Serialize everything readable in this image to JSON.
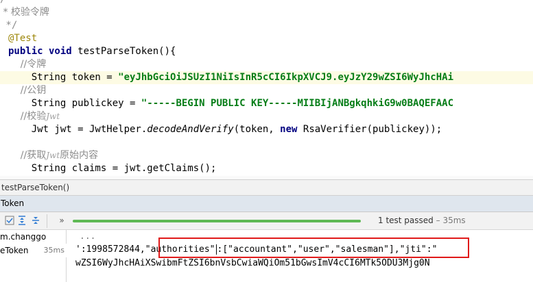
{
  "editor": {
    "lines": [
      {
        "text": "/**"
      },
      {
        "text": " * 校验令牌"
      },
      {
        "text": " */"
      },
      {
        "text": "@Test"
      },
      {
        "kw": "public void",
        "rest": " testParseToken(){"
      },
      {
        "text": "    //令牌"
      },
      {
        "prefix": "    String token = ",
        "str": "\"eyJhbGciOiJSUzI1NiIsInR5cCI6IkpXVCJ9.eyJzY29wZSI6WyJhcHAi"
      },
      {
        "text": "    //公钥"
      },
      {
        "prefix": "    String publickey = ",
        "str": "\"-----BEGIN PUBLIC KEY-----MIIBIjANBgkqhkiG9w0BAQEFAAC"
      },
      {
        "pre": "    //校验",
        "word": "Jwt"
      },
      {
        "a": "    Jwt jwt = JwtHelper.",
        "b": "decodeAndVerify",
        "c": "(token, ",
        "d": "new",
        "e": " RsaVerifier(publickey));"
      },
      {
        "text": ""
      },
      {
        "pre": "    //获取",
        "word": "Jwt",
        "post": "原始内容"
      },
      {
        "text": "    String claims = jwt.getClaims();"
      }
    ]
  },
  "breadcrumb": "testParseToken()",
  "run_panel": {
    "title": "Token",
    "status": "1 test passed",
    "status_duration": "– 35ms",
    "progress": 1.0,
    "more": "»"
  },
  "tree": {
    "root": "m.changgo",
    "item": "eToken",
    "item_duration": "35ms"
  },
  "console": {
    "ellipsis": "...",
    "line1_pre": "':1998572844,",
    "line1_key": "\"authorities\"",
    "line1_val": ":[\"accountant\",\"user\",\"salesman\"],",
    "line1_post": "\"jti\":\"",
    "line2": "wZSI6WyJhcHAiXSwibmFtZSI6bnVsbCwiaWQiOm51bGwsImV4cCI6MTk5ODU3Mjg0N"
  },
  "colors": {
    "string": "#067d17",
    "keyword": "#000080",
    "annotation": "#9e880d",
    "progress": "#5fb955",
    "highlight_box": "#e01919"
  }
}
